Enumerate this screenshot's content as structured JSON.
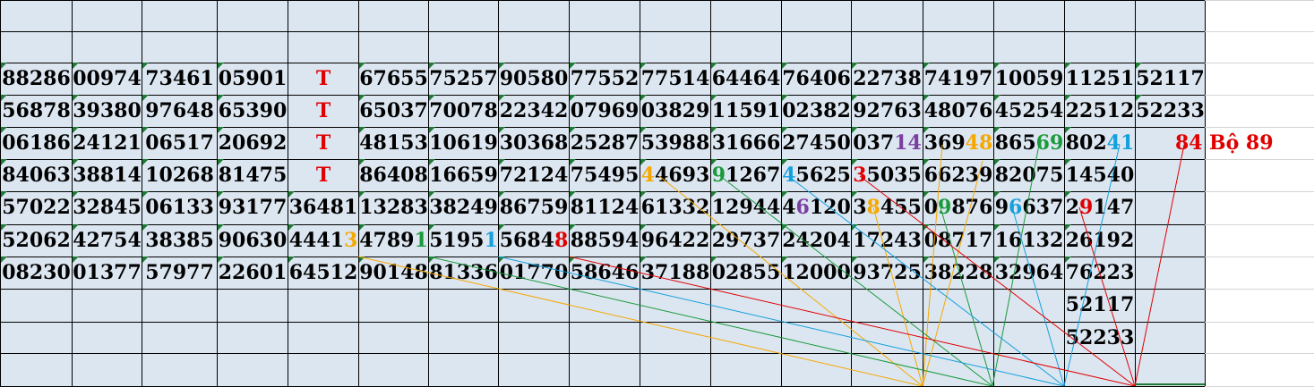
{
  "colors": {
    "red": "#e00000",
    "orange": "#f5a800",
    "green": "#1a9a3a",
    "blue": "#14a0dc",
    "purple": "#7b3fa0",
    "black": "#000000",
    "cell_bg": "#dce6f1",
    "corner_marker": "#1e7b34"
  },
  "grid": {
    "rows": [
      [
        "88286",
        "00974",
        "73461",
        "05901",
        "T",
        "67655",
        "75257",
        "90580",
        "77552",
        "77514",
        "64464",
        "76406",
        "22738",
        "74197",
        "10059",
        "11251",
        "52117"
      ],
      [
        "56878",
        "39380",
        "97648",
        "65390",
        "T",
        "65037",
        "70078",
        "22342",
        "07969",
        "03829",
        "11591",
        "02382",
        "92763",
        "48076",
        "45254",
        "22512",
        "52233"
      ],
      [
        "06186",
        "24121",
        "06517",
        "20692",
        "T",
        "48153",
        "10619",
        "30368",
        "25287",
        "53988",
        "31666",
        "27450",
        "03714",
        "36948",
        "86569",
        "80241",
        ""
      ],
      [
        "84063",
        "38814",
        "10268",
        "81475",
        "T",
        "86408",
        "16659",
        "72124",
        "75495",
        "44693",
        "91267",
        "45625",
        "35035",
        "66239",
        "82075",
        "14540",
        ""
      ],
      [
        "57022",
        "32845",
        "06133",
        "93177",
        "36481",
        "13283",
        "38249",
        "86759",
        "81124",
        "61332",
        "12944",
        "46120",
        "38455",
        "09876",
        "96637",
        "29147",
        ""
      ],
      [
        "52062",
        "42754",
        "38385",
        "90630",
        "44413",
        "47891",
        "51951",
        "56848",
        "88594",
        "96422",
        "29737",
        "24204",
        "17243",
        "08717",
        "16132",
        "26192",
        ""
      ],
      [
        "08230",
        "01377",
        "57977",
        "22601",
        "64512",
        "90148",
        "81336",
        "01770",
        "58646",
        "37188",
        "02855",
        "12000",
        "93725",
        "38228",
        "32964",
        "76223",
        ""
      ],
      [
        "",
        "",
        "",
        "",
        "",
        "",
        "",
        "",
        "",
        "",
        "",
        "",
        "",
        "",
        "",
        "52117",
        ""
      ],
      [
        "",
        "",
        "",
        "",
        "",
        "",
        "",
        "",
        "",
        "",
        "",
        "",
        "",
        "",
        "",
        "52233",
        ""
      ]
    ],
    "highlights": [
      {
        "row": 2,
        "col": 12,
        "pos": 3,
        "len": 2,
        "color": "purple"
      },
      {
        "row": 2,
        "col": 13,
        "pos": 3,
        "len": 2,
        "color": "orange"
      },
      {
        "row": 2,
        "col": 14,
        "pos": 3,
        "len": 2,
        "color": "green"
      },
      {
        "row": 2,
        "col": 15,
        "pos": 3,
        "len": 2,
        "color": "blue"
      },
      {
        "row": 3,
        "col": 9,
        "pos": 0,
        "len": 1,
        "color": "orange"
      },
      {
        "row": 3,
        "col": 10,
        "pos": 0,
        "len": 1,
        "color": "green"
      },
      {
        "row": 3,
        "col": 11,
        "pos": 0,
        "len": 1,
        "color": "blue"
      },
      {
        "row": 3,
        "col": 12,
        "pos": 0,
        "len": 1,
        "color": "red"
      },
      {
        "row": 4,
        "col": 11,
        "pos": 1,
        "len": 1,
        "color": "purple"
      },
      {
        "row": 4,
        "col": 12,
        "pos": 1,
        "len": 1,
        "color": "orange"
      },
      {
        "row": 4,
        "col": 13,
        "pos": 1,
        "len": 1,
        "color": "green"
      },
      {
        "row": 4,
        "col": 14,
        "pos": 1,
        "len": 1,
        "color": "blue"
      },
      {
        "row": 4,
        "col": 15,
        "pos": 1,
        "len": 1,
        "color": "red"
      },
      {
        "row": 5,
        "col": 4,
        "pos": 4,
        "len": 1,
        "color": "orange"
      },
      {
        "row": 5,
        "col": 5,
        "pos": 4,
        "len": 1,
        "color": "green"
      },
      {
        "row": 5,
        "col": 6,
        "pos": 4,
        "len": 1,
        "color": "blue"
      },
      {
        "row": 5,
        "col": 7,
        "pos": 4,
        "len": 1,
        "color": "red"
      }
    ],
    "side_result": {
      "number": "84",
      "label": "Bộ 89"
    }
  }
}
